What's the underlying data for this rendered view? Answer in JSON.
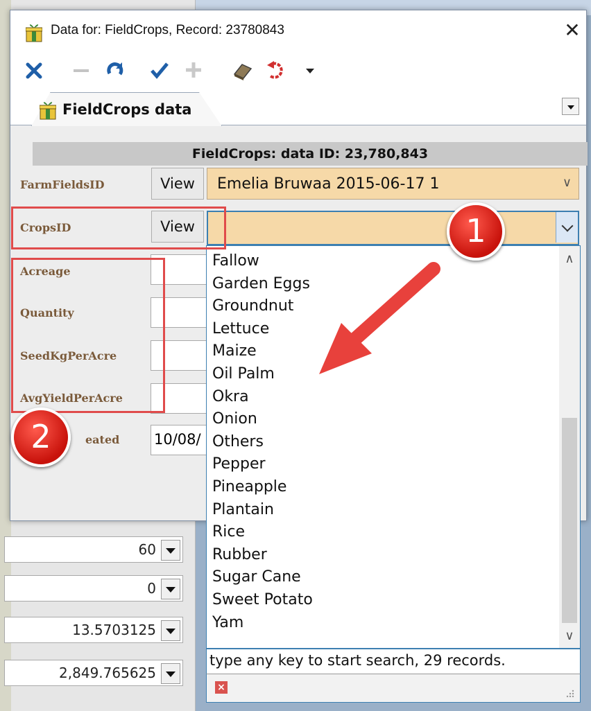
{
  "window": {
    "title": "Data for: FieldCrops, Record: 23780843",
    "close_glyph": "✕"
  },
  "toolbar": {
    "icons": [
      "cancel-icon",
      "delete-icon",
      "refresh-icon",
      "save-check-icon",
      "add-icon",
      "eraser-icon",
      "undo-icon",
      "dropdown-arrow-icon"
    ]
  },
  "tab": {
    "label": "FieldCrops data"
  },
  "header": {
    "text": "FieldCrops: data ID: 23,780,843"
  },
  "fields": {
    "farm_fields_id": {
      "label": "FarmFieldsID",
      "view_label": "View",
      "value": "Emelia Bruwaa 2015-06-17 1"
    },
    "crops_id": {
      "label": "CropsID",
      "view_label": "View",
      "value": ""
    },
    "acreage": {
      "label": "Acreage"
    },
    "quantity": {
      "label": "Quantity"
    },
    "seed_kg_per_acre": {
      "label": "SeedKgPerAcre"
    },
    "avg_yield_per_acre": {
      "label": "AvgYieldPerAcre"
    },
    "date_created": {
      "label": "eated",
      "value": "10/08/"
    }
  },
  "dropdown": {
    "options": [
      "Fallow",
      "Garden Eggs",
      "Groundnut",
      "Lettuce",
      "Maize",
      "Oil Palm",
      "Okra",
      "Onion",
      "Others",
      "Pepper",
      "Pineapple",
      "Plantain",
      "Rice",
      "Rubber",
      "Sugar Cane",
      "Sweet Potato",
      "Yam"
    ],
    "footer_text": "type any key to start search, 29 records."
  },
  "background_values": [
    "60",
    "0",
    "13.5703125",
    "2,849.765625"
  ],
  "annotations": {
    "badge_1": "1",
    "badge_2": "2"
  },
  "colors": {
    "combo_fill": "#f6d9a8",
    "label_text": "#7a5a3a",
    "highlight": "#e04b4b",
    "focus_border": "#3c7fb1"
  }
}
